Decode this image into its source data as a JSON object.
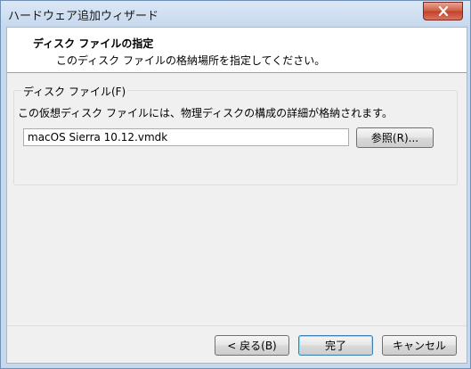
{
  "window": {
    "title": "ハードウェア追加ウィザード"
  },
  "header": {
    "title": "ディスク ファイルの指定",
    "subtitle": "このディスク ファイルの格納場所を指定してください。"
  },
  "disk_file": {
    "group_label": "ディスク ファイル(F)",
    "description": "この仮想ディスク ファイルには、物理ディスクの構成の詳細が格納されます。",
    "path_value": "macOS Sierra 10.12.vmdk",
    "browse_label": "参照(R)..."
  },
  "footer": {
    "back_label": "< 戻る(B)",
    "finish_label": "完了",
    "cancel_label": "キャンセル"
  },
  "colors": {
    "close_button": "#c2402a",
    "title_bar": "#c6d8ee",
    "default_button_border": "#3c7fb1"
  },
  "icons": {
    "close": "close-icon"
  }
}
